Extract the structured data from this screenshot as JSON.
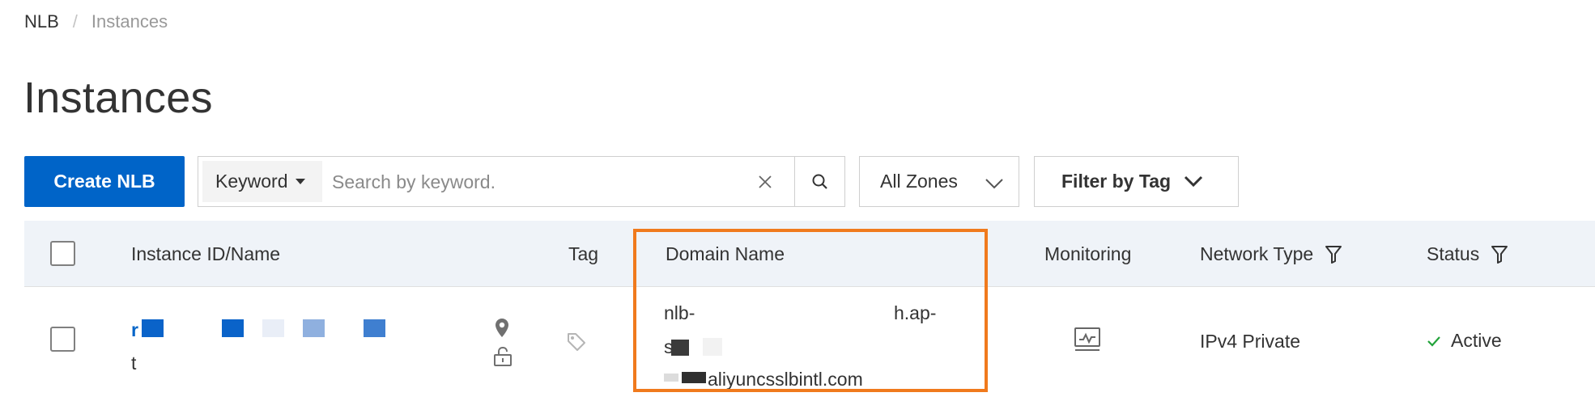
{
  "breadcrumb": {
    "root": "NLB",
    "separator": "/",
    "current": "Instances"
  },
  "page": {
    "title": "Instances"
  },
  "toolbar": {
    "create_label": "Create NLB",
    "keyword_select": "Keyword",
    "search_placeholder": "Search by keyword.",
    "zones_label": "All Zones",
    "tag_filter_label": "Filter by Tag"
  },
  "table": {
    "columns": {
      "instance": "Instance ID/Name",
      "tag": "Tag",
      "domain": "Domain Name",
      "monitoring": "Monitoring",
      "network_type": "Network Type",
      "status": "Status"
    },
    "rows": [
      {
        "id_prefix": "r",
        "name": "t",
        "domain_line1_start": "nlb-",
        "domain_line1_end": "h.ap-",
        "domain_line2": "s",
        "domain_line3": "aliyuncsslbintl.com",
        "network_type": "IPv4 Private",
        "status": "Active"
      }
    ]
  },
  "colors": {
    "primary": "#0064c8",
    "highlight": "#f07a1d",
    "header_bg": "#eff3f8",
    "status_active": "#22a33a"
  }
}
